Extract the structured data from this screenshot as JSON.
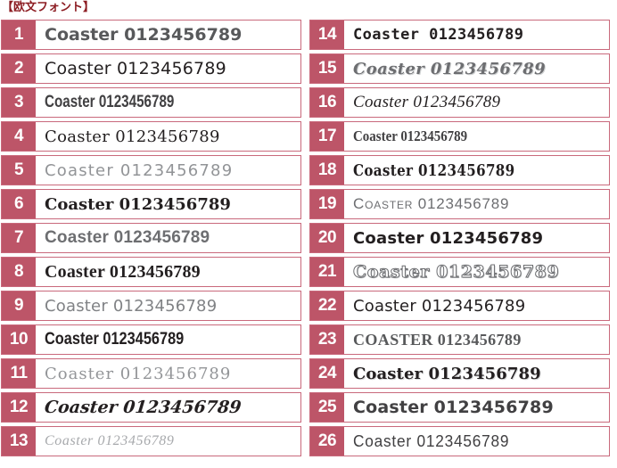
{
  "header": {
    "title": "【欧文フォント】",
    "color": "#8c1c22"
  },
  "theme": {
    "badge_bg": "#bd5568",
    "row_border": "#c9697c",
    "row_bg": "#ffffff",
    "text_default": "#231f20"
  },
  "sample_text": "Coaster 0123456789",
  "columns": [
    {
      "name": "left-column",
      "rows": [
        {
          "number": "1",
          "text": "Coaster 0123456789",
          "style": "f1"
        },
        {
          "number": "2",
          "text": "Coaster 0123456789",
          "style": "f2"
        },
        {
          "number": "3",
          "text": "Coaster 0123456789",
          "style": "f3"
        },
        {
          "number": "4",
          "text": "Coaster 0123456789",
          "style": "f4"
        },
        {
          "number": "5",
          "text": "Coaster 0123456789",
          "style": "f5"
        },
        {
          "number": "6",
          "text": "Coaster 0123456789",
          "style": "f6"
        },
        {
          "number": "7",
          "text": "Coaster 0123456789",
          "style": "f7"
        },
        {
          "number": "8",
          "text": "Coaster 0123456789",
          "style": "f8"
        },
        {
          "number": "9",
          "text": "Coaster 0123456789",
          "style": "f9"
        },
        {
          "number": "10",
          "text": "Coaster 0123456789",
          "style": "f10"
        },
        {
          "number": "11",
          "text": "Coaster 0123456789",
          "style": "f11"
        },
        {
          "number": "12",
          "text": "Coaster 0123456789",
          "style": "f12"
        },
        {
          "number": "13",
          "text": "Coaster 0123456789",
          "style": "f13"
        }
      ]
    },
    {
      "name": "right-column",
      "rows": [
        {
          "number": "14",
          "text": "Coaster 0123456789",
          "style": "f14"
        },
        {
          "number": "15",
          "text": "Coaster 0123456789",
          "style": "f15"
        },
        {
          "number": "16",
          "text": "Coaster 0123456789",
          "style": "f16"
        },
        {
          "number": "17",
          "text": "Coaster 0123456789",
          "style": "f17"
        },
        {
          "number": "18",
          "text": "Coaster 0123456789",
          "style": "f18"
        },
        {
          "number": "19",
          "text": "Coaster 0123456789",
          "style": "f19"
        },
        {
          "number": "20",
          "text": "Coaster 0123456789",
          "style": "f20"
        },
        {
          "number": "21",
          "text": "Coaster 0123456789",
          "style": "f21"
        },
        {
          "number": "22",
          "text": "Coaster 0123456789",
          "style": "f22"
        },
        {
          "number": "23",
          "text": "COASTER 0123456789",
          "style": "f23"
        },
        {
          "number": "24",
          "text": "Coaster 0123456789",
          "style": "f24"
        },
        {
          "number": "25",
          "text": "Coaster 0123456789",
          "style": "f25"
        },
        {
          "number": "26",
          "text": "Coaster 0123456789",
          "style": "f26"
        }
      ]
    }
  ]
}
